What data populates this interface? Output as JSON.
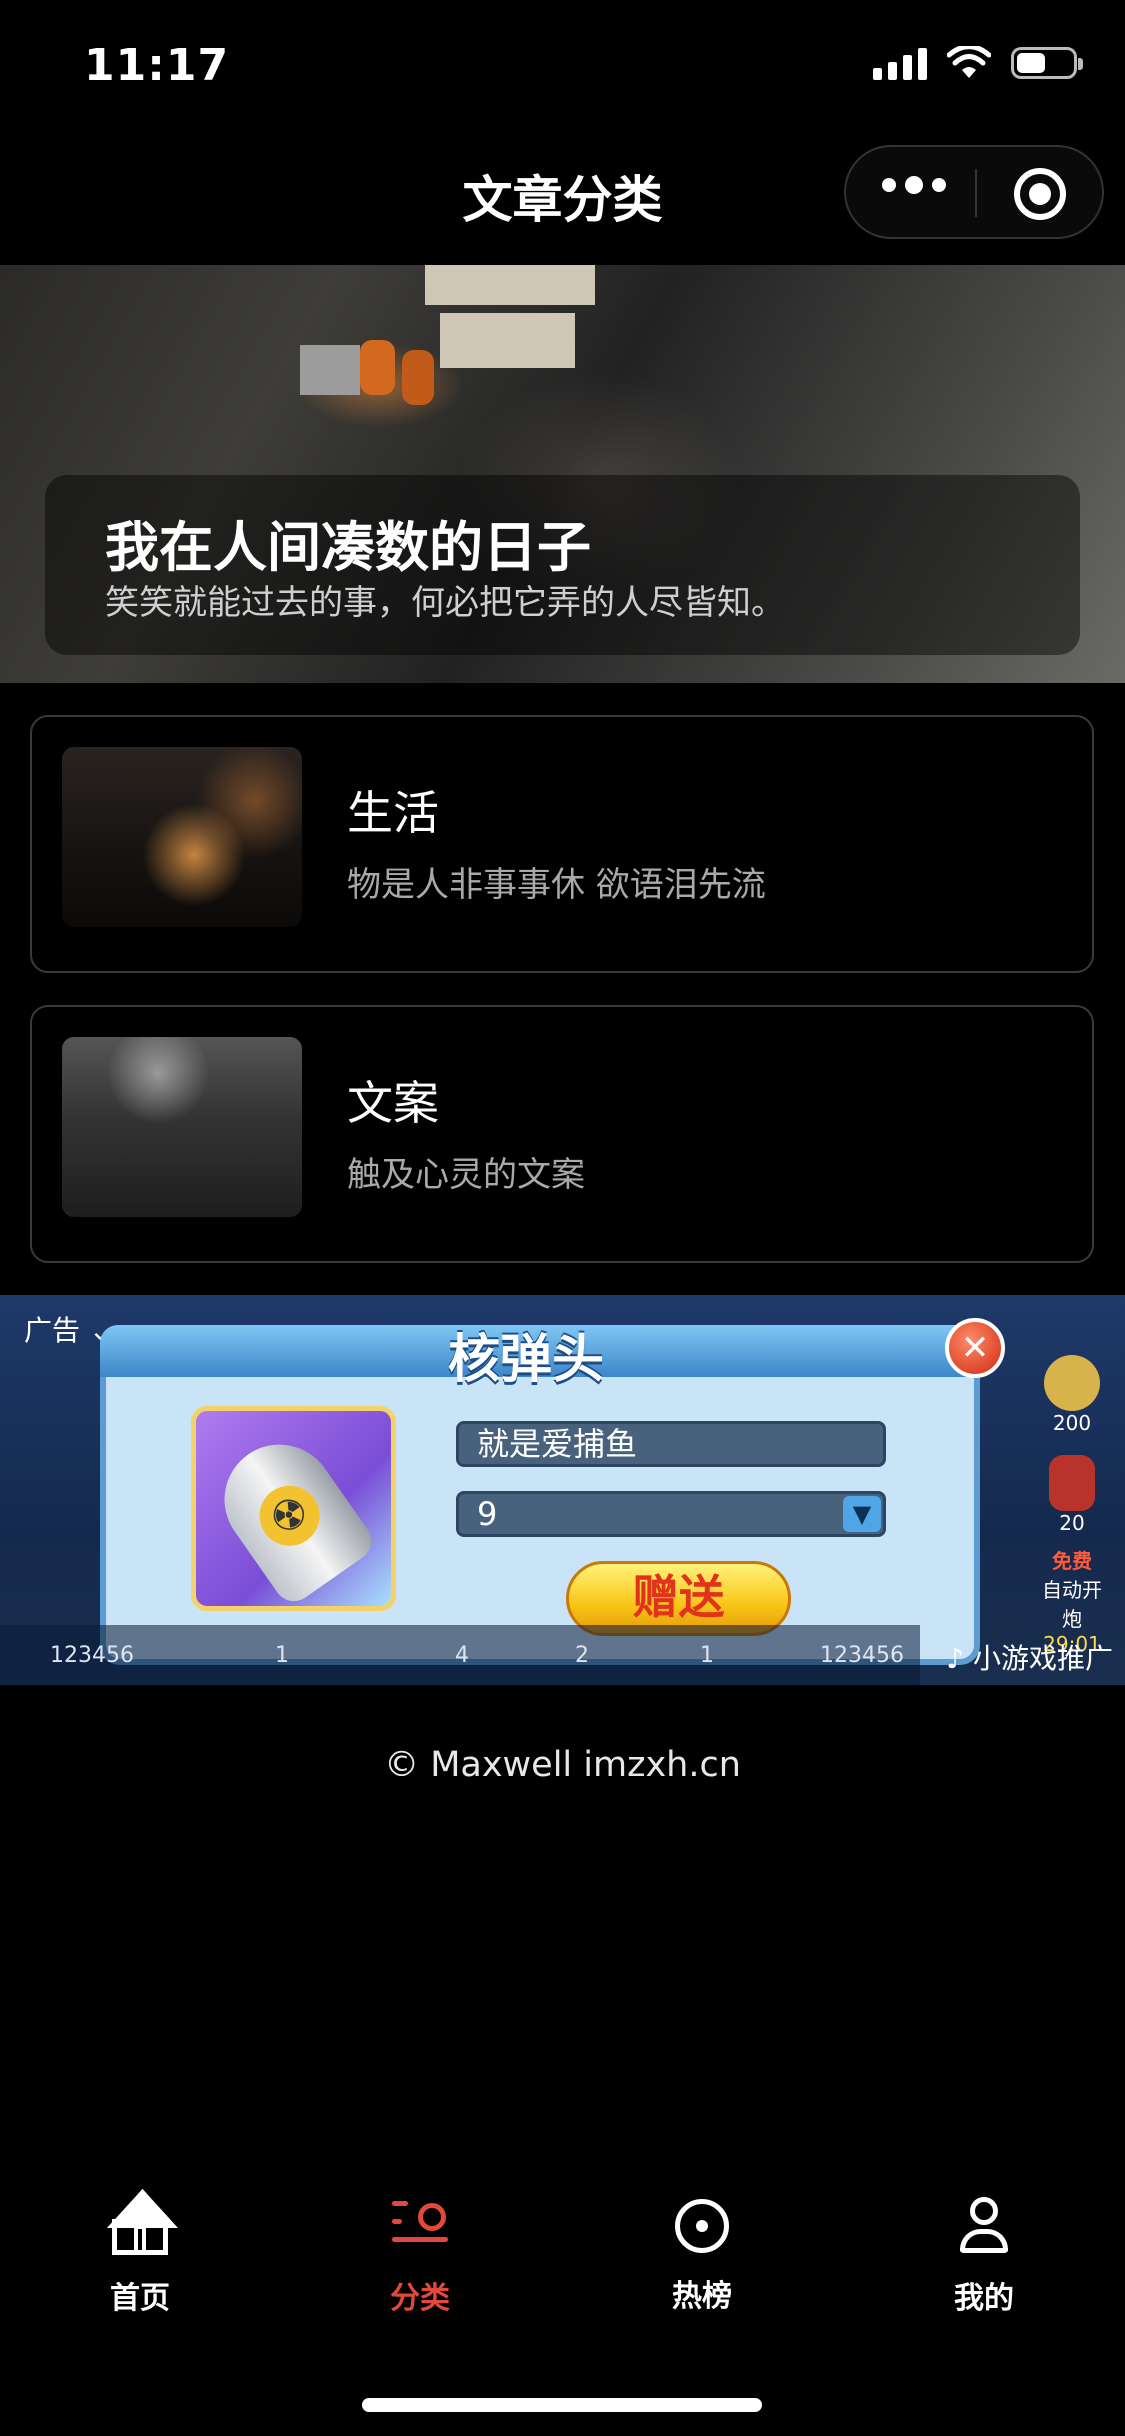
{
  "status_bar": {
    "time": "11:17"
  },
  "nav": {
    "title": "文章分类"
  },
  "banner": {
    "title": "我在人间凑数的日子",
    "subtitle": "笑笑就能过去的事，何必把它弄的人尽皆知。"
  },
  "categories": [
    {
      "title": "生活",
      "desc": "物是人非事事休 欲语泪先流"
    },
    {
      "title": "文案",
      "desc": "触及心灵的文案"
    }
  ],
  "ad": {
    "label": "广告",
    "title": "核弹头",
    "player_name": "就是爱捕鱼",
    "quantity": "9",
    "send_label": "赠送",
    "promo_label": "小游戏推广",
    "side_values": [
      "200",
      "20"
    ],
    "side_free": "免费",
    "side_auto": "自动开炮",
    "side_timer": "29:01",
    "bottom_values": [
      "123456",
      "1",
      "4",
      "2",
      "1",
      "123456"
    ]
  },
  "footer": {
    "copyright": "© Maxwell imzxh.cn"
  },
  "tabbar": {
    "items": [
      {
        "label": "首页",
        "icon": "home-icon"
      },
      {
        "label": "分类",
        "icon": "category-search-icon",
        "active": true
      },
      {
        "label": "热榜",
        "icon": "target-icon"
      },
      {
        "label": "我的",
        "icon": "user-icon"
      }
    ]
  },
  "colors": {
    "accent": "#e2493a",
    "background": "#000000"
  }
}
